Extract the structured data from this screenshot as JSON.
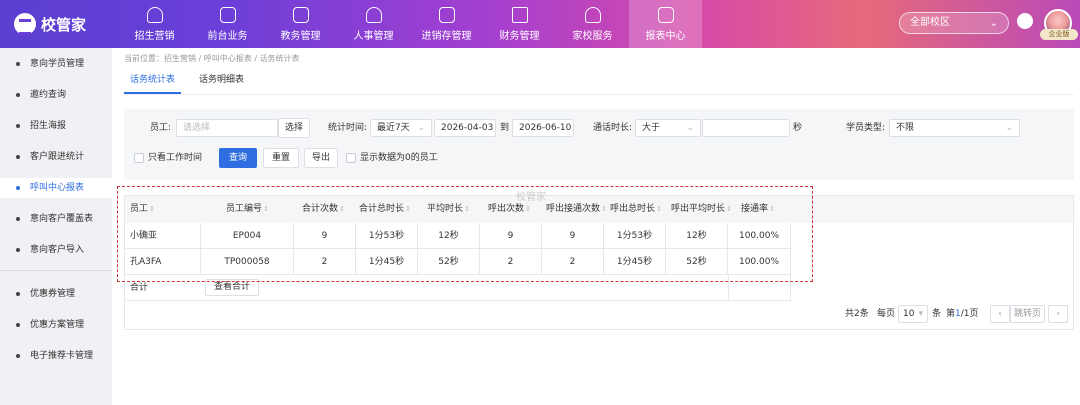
{
  "brand": {
    "name": "校管家"
  },
  "nav": [
    {
      "label": "招生营销",
      "icon": "person-plus-icon"
    },
    {
      "label": "前台业务",
      "icon": "desk-icon"
    },
    {
      "label": "教务管理",
      "icon": "book-icon"
    },
    {
      "label": "人事管理",
      "icon": "person-icon"
    },
    {
      "label": "进销存管理",
      "icon": "inventory-icon"
    },
    {
      "label": "财务管理",
      "icon": "finance-icon"
    },
    {
      "label": "家校服务",
      "icon": "chat-bubble-icon"
    },
    {
      "label": "报表中心",
      "icon": "report-icon"
    }
  ],
  "campus_select": {
    "value": "全部校区"
  },
  "user": {
    "badge": "企业版"
  },
  "sidebar": {
    "items": [
      {
        "label": "意向学员管理"
      },
      {
        "label": "邀约查询"
      },
      {
        "label": "招生海报"
      },
      {
        "label": "客户跟进统计"
      },
      {
        "label": "呼叫中心报表"
      },
      {
        "label": "意向客户覆盖表"
      },
      {
        "label": "意向客户导入"
      },
      {
        "label": "优惠券管理"
      },
      {
        "label": "优惠方案管理"
      },
      {
        "label": "电子推荐卡管理"
      }
    ]
  },
  "breadcrumb": "当前位置：招生营销 / 呼叫中心报表 / 话务统计表",
  "tabs": [
    {
      "label": "话务统计表"
    },
    {
      "label": "话务明细表"
    }
  ],
  "filters": {
    "staff_label": "员工:",
    "staff_placeholder": "请选择",
    "select_btn": "选择",
    "time_label": "统计时间:",
    "time_range": "最近7天",
    "date_from": "2026-04-03",
    "to_label": "到",
    "date_to": "2026-06-10",
    "duration_label": "通话时长:",
    "duration_op": "大于",
    "duration_value": "",
    "duration_unit": "秒",
    "student_type_label": "学员类型:",
    "student_type": "不限",
    "only_work_time": "只看工作时间",
    "query_btn": "查询",
    "reset_btn": "重置",
    "export_btn": "导出",
    "show_zero": "显示数据为0的员工"
  },
  "table": {
    "headers": [
      "员工",
      "员工编号",
      "合计次数",
      "合计总时长",
      "平均时长",
      "呼出次数",
      "呼出接通次数",
      "呼出总时长",
      "呼出平均时长",
      "接通率"
    ],
    "rows": [
      [
        "小确亚",
        "EP004",
        "9",
        "1分53秒",
        "12秒",
        "9",
        "9",
        "1分53秒",
        "12秒",
        "100.00%"
      ],
      [
        "孔A3FA",
        "TP000058",
        "2",
        "1分45秒",
        "52秒",
        "2",
        "2",
        "1分45秒",
        "52秒",
        "100.00%"
      ]
    ],
    "total_label": "合计",
    "total_btn": "查看合计"
  },
  "watermark": "校管家",
  "pagination": {
    "total": "共2条",
    "per_page_label": "每页",
    "per_page": "10",
    "unit": "条",
    "page_prefix": "第",
    "current": "1",
    "page_suffix": "/1页",
    "jump_label": "跳转页"
  }
}
